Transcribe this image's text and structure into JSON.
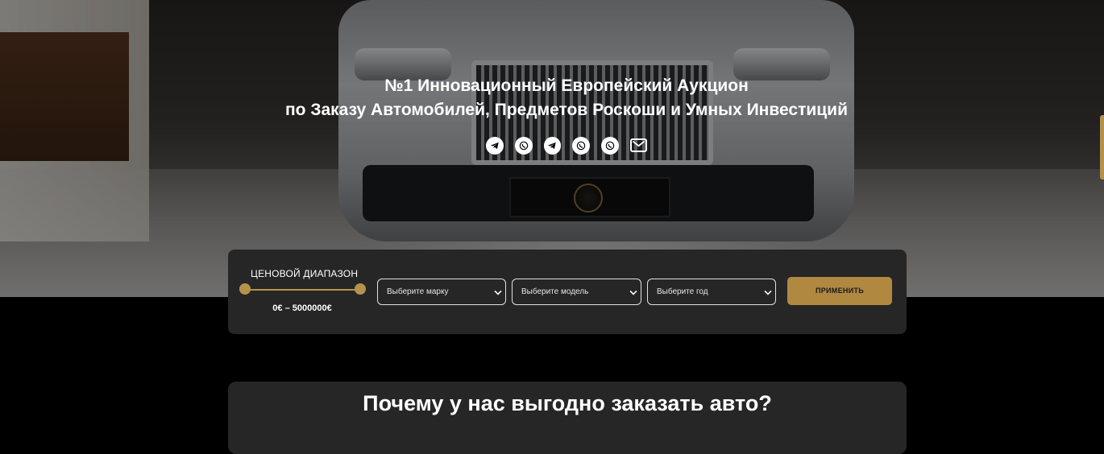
{
  "hero": {
    "title_line1": "№1 Инновационный Европейский Аукцион",
    "title_line2": "по Заказу Автомобилей, Предметов Роскоши и Умных Инвестиций",
    "socials": [
      "telegram-icon",
      "whatsapp-icon",
      "telegram-icon",
      "whatsapp-icon",
      "whatsapp-icon",
      "mail-icon"
    ]
  },
  "filter": {
    "range_label": "ЦЕНОВОЙ ДИАПАЗОН",
    "range_value": "0€ – 5000000€",
    "brand_placeholder": "Выберите марку",
    "model_placeholder": "Выберите модель",
    "year_placeholder": "Выберите год",
    "apply_label": "ПРИМЕНИТЬ"
  },
  "why": {
    "heading": "Почему у нас выгодно заказать авто?"
  },
  "colors": {
    "accent": "#b5924c",
    "panel": "#262626",
    "background": "#000000"
  }
}
